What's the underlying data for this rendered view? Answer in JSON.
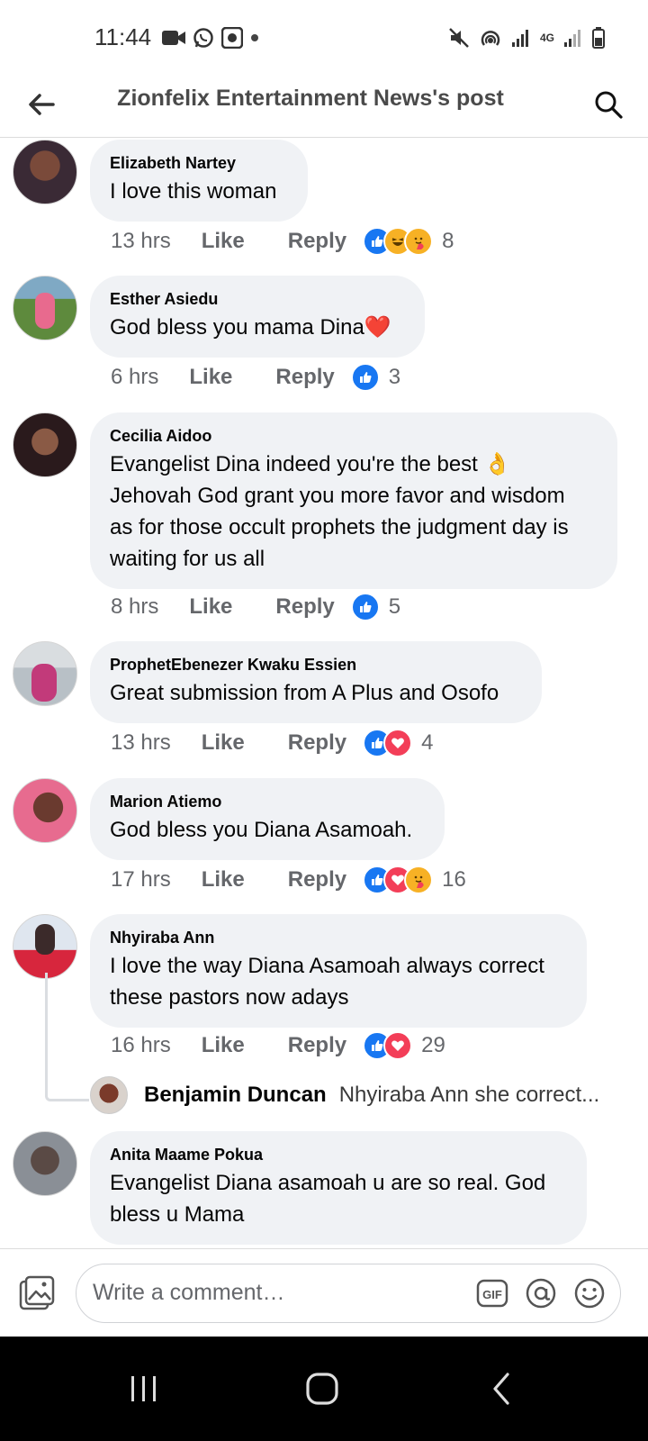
{
  "status_bar": {
    "time": "11:44",
    "network_label": "4G"
  },
  "header": {
    "title": "Zionfelix Entertainment News's post"
  },
  "actions": {
    "like": "Like",
    "reply": "Reply"
  },
  "comments": [
    {
      "author": "Elizabeth Nartey",
      "text": "I love this woman",
      "time": "13 hrs",
      "reactions": [
        "like",
        "haha",
        "care"
      ],
      "count": "8"
    },
    {
      "author": "Esther Asiedu",
      "text": "God bless you mama Dina❤️",
      "time": "6 hrs",
      "reactions": [
        "like"
      ],
      "count": "3"
    },
    {
      "author": "Cecilia Aidoo",
      "text_lines": [
        "Evangelist Dina indeed you're the best 👌",
        "Jehovah God grant you more favor and wisdom",
        "as for those occult prophets the judgment day is",
        "waiting for us all"
      ],
      "time": "8 hrs",
      "reactions": [
        "like"
      ],
      "count": "5"
    },
    {
      "author": "ProphetEbenezer Kwaku Essien",
      "text": "Great submission from A Plus and Osofo",
      "time": "13 hrs",
      "reactions": [
        "like",
        "love"
      ],
      "count": "4"
    },
    {
      "author": "Marion Atiemo",
      "text": "God bless you Diana Asamoah.",
      "time": "17 hrs",
      "reactions": [
        "like",
        "love",
        "care"
      ],
      "count": "16"
    },
    {
      "author": "Nhyiraba Ann",
      "text_lines": [
        "I love the way Diana Asamoah always correct",
        "these pastors now adays"
      ],
      "time": "16 hrs",
      "reactions": [
        "like",
        "love"
      ],
      "count": "29",
      "reply": {
        "author": "Benjamin Duncan",
        "text": "Nhyiraba Ann she correct..."
      }
    },
    {
      "author": "Anita Maame Pokua",
      "text_lines": [
        "Evangelist Diana asamoah u are so real.  God",
        "bless u Mama"
      ]
    }
  ],
  "composer": {
    "placeholder": "Write a comment…",
    "gif_label": "GIF"
  },
  "colors": {
    "like_blue": "#1877f2",
    "love_red": "#f33e58",
    "care_yellow": "#f7b125",
    "bubble_gray": "#f0f2f5"
  }
}
